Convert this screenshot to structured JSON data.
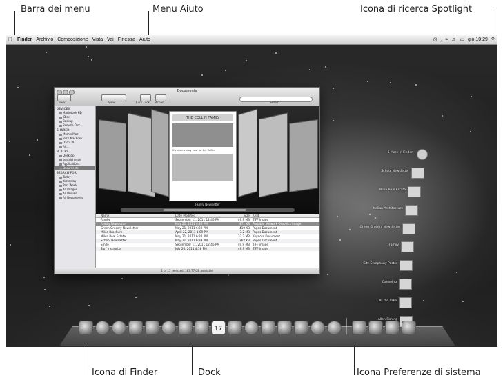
{
  "callouts": {
    "menubar": "Barra dei menu",
    "help_menu": "Menu Aiuto",
    "spotlight": "Icona di ricerca Spotlight",
    "finder_icon": "Icona di Finder",
    "dock": "Dock",
    "sysprefs": "Icona Preferenze di sistema"
  },
  "menubar": {
    "apple": "",
    "items": [
      "Finder",
      "Archivio",
      "Composizione",
      "Vista",
      "Vai",
      "Finestra",
      "Aiuto"
    ],
    "clock": "gio 10:29",
    "spotlight_glyph": "⚲"
  },
  "finder": {
    "title": "Documents",
    "toolbar": {
      "back": "Back",
      "view": "View",
      "quicklook": "Quick Look",
      "action": "Action",
      "search": "Search"
    },
    "sidebar": [
      {
        "head": "DEVICES"
      },
      {
        "item": "Macintosh HD"
      },
      {
        "item": "iDisk"
      },
      {
        "item": "Backup"
      },
      {
        "item": "Remote Disc"
      },
      {
        "head": "SHARED"
      },
      {
        "item": "Mom's Mac"
      },
      {
        "item": "Bill's MacBook"
      },
      {
        "item": "Dad's PC"
      },
      {
        "item": "All..."
      },
      {
        "head": "PLACES"
      },
      {
        "item": "Desktop"
      },
      {
        "item": "sentsjohnson"
      },
      {
        "item": "Applications"
      },
      {
        "item": "Documents",
        "selected": true
      },
      {
        "head": "SEARCH FOR"
      },
      {
        "item": "Today"
      },
      {
        "item": "Yesterday"
      },
      {
        "item": "Past Week"
      },
      {
        "item": "All Images"
      },
      {
        "item": "All Movies"
      },
      {
        "item": "All Documents"
      }
    ],
    "coverflow_caption": "Family Newsletter",
    "cover_title": "THE COLLIN FAMILY",
    "cover_subtitle": "It's been a busy year for the Collins",
    "columns": [
      "Name",
      "Date Modified",
      "Size",
      "Kind"
    ],
    "rows": [
      [
        "Family",
        "September 11, 2011 12:46 PM",
        "49.9 MB",
        "TIFF image"
      ],
      [
        "Family Newsletter",
        "May 21, 2011 6:30 PM",
        "471 KB",
        "Portable Network Graphics image"
      ],
      [
        "Green Grocery Newsletter",
        "May 21, 2011 6:32 PM",
        "410 KB",
        "Pages Document"
      ],
      [
        "Milea Brochure",
        "April 22, 2011 1:09 PM",
        "7.2 MB",
        "Pages Document"
      ],
      [
        "Milea Real Estate",
        "May 21, 2011 6:32 PM",
        "33.2 MB",
        "Keynote Document"
      ],
      [
        "School Newsletter",
        "May 21, 2011 6:33 PM",
        "262 KB",
        "Pages Document"
      ],
      [
        "Smile",
        "September 11, 2011 12:46 PM",
        "49.9 MB",
        "TIFF image"
      ],
      [
        "Surf Instructor",
        "July 26, 2011 4:58 PM",
        "49.9 MB",
        "TIFF image"
      ]
    ],
    "selected_row": 1,
    "status": "1 of 15 selected, 183.77 GB available"
  },
  "stack": {
    "items": [
      "5 More in Finder",
      "School Newsletter",
      "Milea Real Estate",
      "Italian Architecture",
      "Green Grocery Newsletter",
      "Family",
      "City Symphony Poster",
      "Canoeing",
      "At the Lake",
      "Allen Fishing"
    ]
  },
  "dock": {
    "left_icons": [
      "finder",
      "app-store",
      "safari",
      "mail",
      "photo-booth",
      "dashboard",
      "facetime",
      "address-book",
      "ical",
      "iphoto",
      "itunes",
      "preview",
      "garageband",
      "imovie",
      "time-machine",
      "system-preferences"
    ],
    "right_icons": [
      "applications-folder",
      "downloads-stack",
      "documents-stack",
      "trash"
    ],
    "ical_day": "17"
  }
}
